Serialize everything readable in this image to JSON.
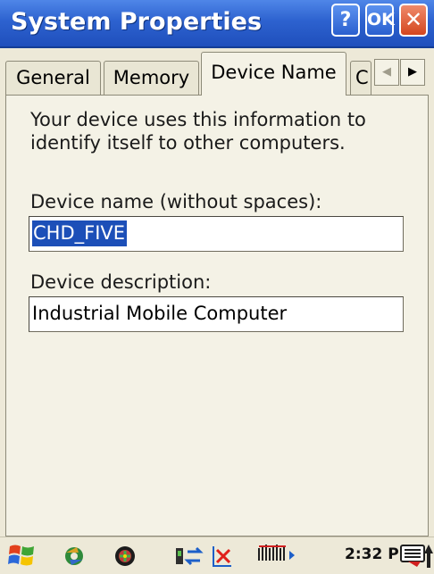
{
  "window": {
    "title": "System Properties",
    "help_label": "?",
    "ok_label": "OK",
    "close_label": "✕"
  },
  "tabs": [
    {
      "label": "General"
    },
    {
      "label": "Memory"
    },
    {
      "label": "Device Name",
      "selected": true
    },
    {
      "label": "C"
    }
  ],
  "tab_scroll": {
    "left": "◀",
    "right": "▶"
  },
  "content": {
    "intro_line1": "Your device uses this information to",
    "intro_line2": "identify itself to other computers.",
    "device_name_label": "Device name (without spaces):",
    "device_name_value": "CHD_FIVE",
    "device_description_label": "Device description:",
    "device_description_value": "Industrial Mobile Computer"
  },
  "taskbar": {
    "time": "2:32 PM",
    "icons": [
      "start-icon",
      "sync-icon",
      "media-icon",
      "connectivity-icon",
      "network-disconnected-icon",
      "signal-icon",
      "keyboard-icon",
      "up-arrow-icon"
    ]
  },
  "colors": {
    "titlebar": "#2d62cf",
    "selection": "#1c4fb8",
    "close_button": "#d4461f",
    "background": "#ede9d8"
  }
}
